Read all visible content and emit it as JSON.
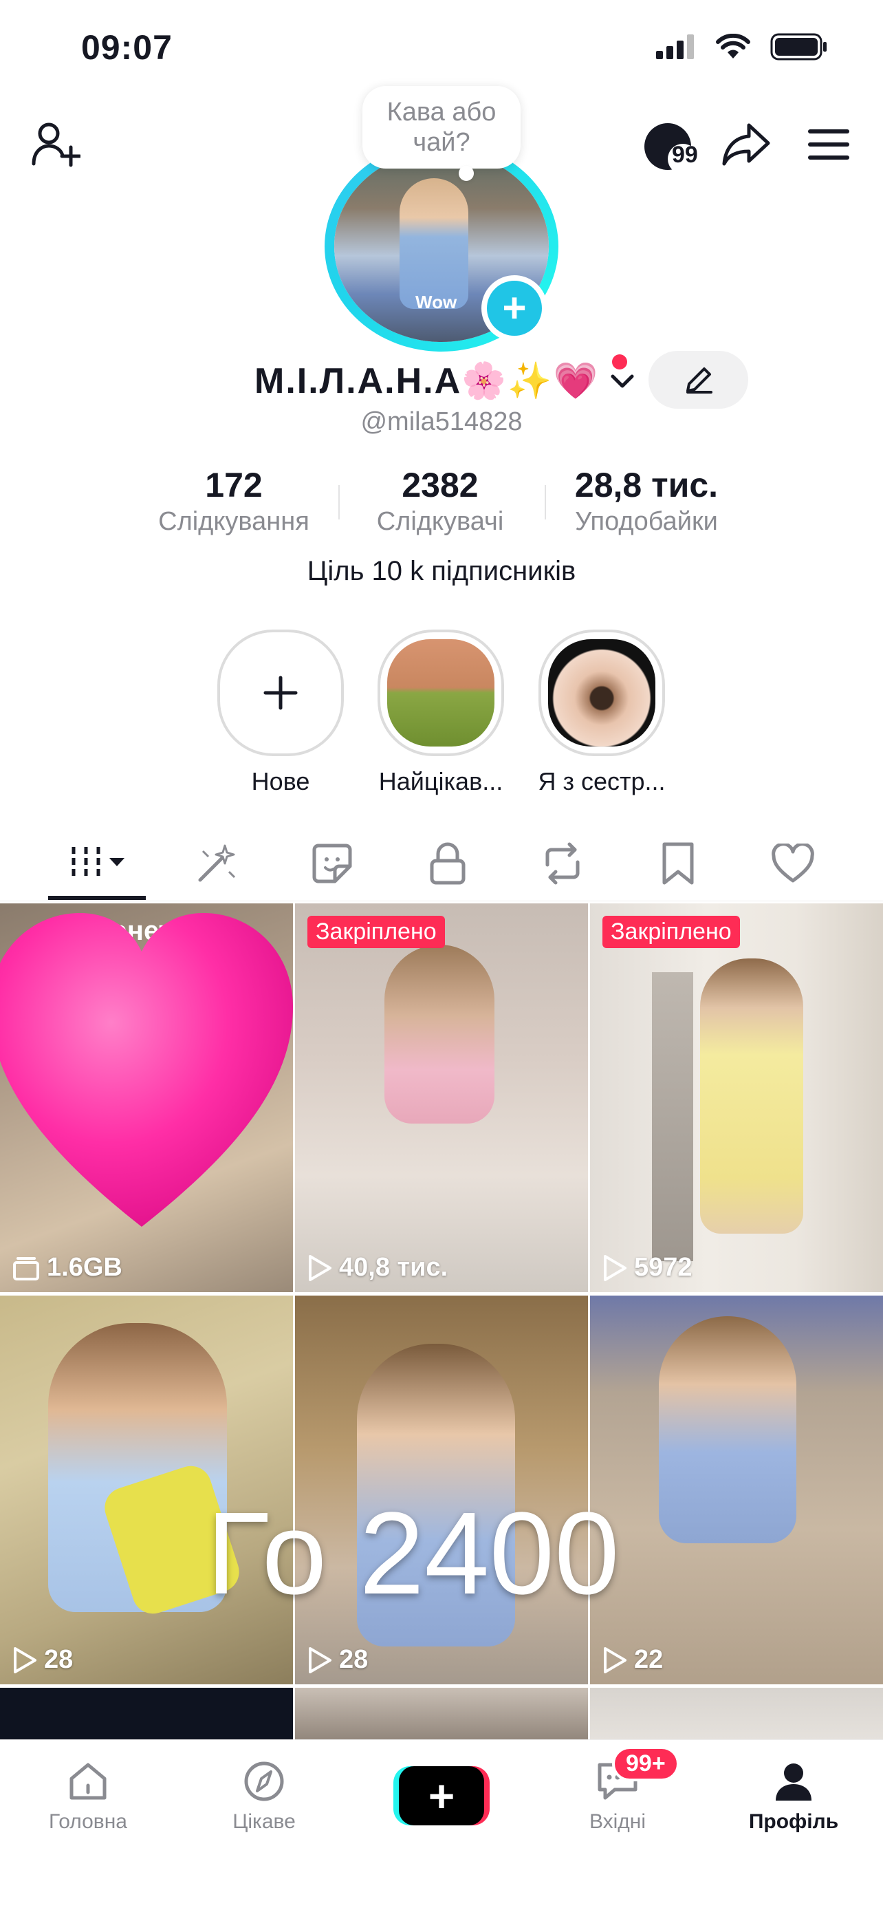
{
  "status_bar": {
    "time": "09:07"
  },
  "header": {
    "coins_badge": "99"
  },
  "profile": {
    "note": "Кава або чай?",
    "avatar_caption": "Wow",
    "display_name": "М.І.Л.А.Н.А🌸✨💗",
    "username": "@mila514828",
    "stats": [
      {
        "value": "172",
        "label": "Слідкування"
      },
      {
        "value": "2382",
        "label": "Слідкувачі"
      },
      {
        "value": "28,8 тис.",
        "label": "Уподобайки"
      }
    ],
    "bio": "Ціль 10 k підписників"
  },
  "highlights": [
    {
      "label": "Нове"
    },
    {
      "label": "Найцікав..."
    },
    {
      "label": "Я з сестр..."
    }
  ],
  "tabs": [
    "videos",
    "reposts-sparkle",
    "stickers",
    "private",
    "reposts",
    "favorites",
    "liked"
  ],
  "grid": {
    "drafts_label": "Чернетки",
    "cells": [
      {
        "pinned": "",
        "meta": "1.6GB"
      },
      {
        "pinned": "Закріплено",
        "meta": "40,8 тис."
      },
      {
        "pinned": "Закріплено",
        "meta": "5972"
      },
      {
        "pinned": "",
        "meta": "28"
      },
      {
        "pinned": "",
        "meta": "28"
      },
      {
        "pinned": "",
        "meta": "22"
      }
    ],
    "overlay_text": "Го 2400"
  },
  "bottom_nav": {
    "items": [
      "Головна",
      "Цікаве",
      "Вхідні",
      "Профіль"
    ],
    "inbox_badge": "99+"
  },
  "colors": {
    "accent": "#fe2c55",
    "cyan": "#25f4ee",
    "ring": "#20d5ec"
  }
}
